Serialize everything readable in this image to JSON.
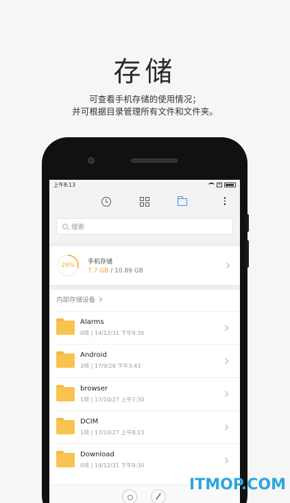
{
  "promo": {
    "title": "存储",
    "line1": "可查看手机存储的使用情况；",
    "line2": "并可根据目录管理所有文件和文件夹。"
  },
  "statusbar": {
    "time": "上午8:13"
  },
  "toolbar": {
    "icons": [
      "clock-icon",
      "grid-icon",
      "folder-icon",
      "more-icon"
    ],
    "active_color": "#3a8ee6"
  },
  "search": {
    "placeholder": "搜索"
  },
  "storage": {
    "percent_label": "29%",
    "percent": 29,
    "title": "手机存储",
    "used": "7.7 GB",
    "total": " / 10.89 GB",
    "accent": "#f5a623"
  },
  "section": {
    "label": "内部存储设备"
  },
  "folders": [
    {
      "name": "Alarms",
      "meta": "0项 | 14/12/31 下午9:30"
    },
    {
      "name": "Android",
      "meta": "3项 | 17/9/29 下午3:43"
    },
    {
      "name": "browser",
      "meta": "1项 | 17/10/27 上午7:30"
    },
    {
      "name": "DCIM",
      "meta": "1项 | 17/10/27 上午8:13"
    },
    {
      "name": "Download",
      "meta": "0项 | 14/12/31 下午9:30"
    }
  ],
  "watermark": "ITMOP.COM"
}
